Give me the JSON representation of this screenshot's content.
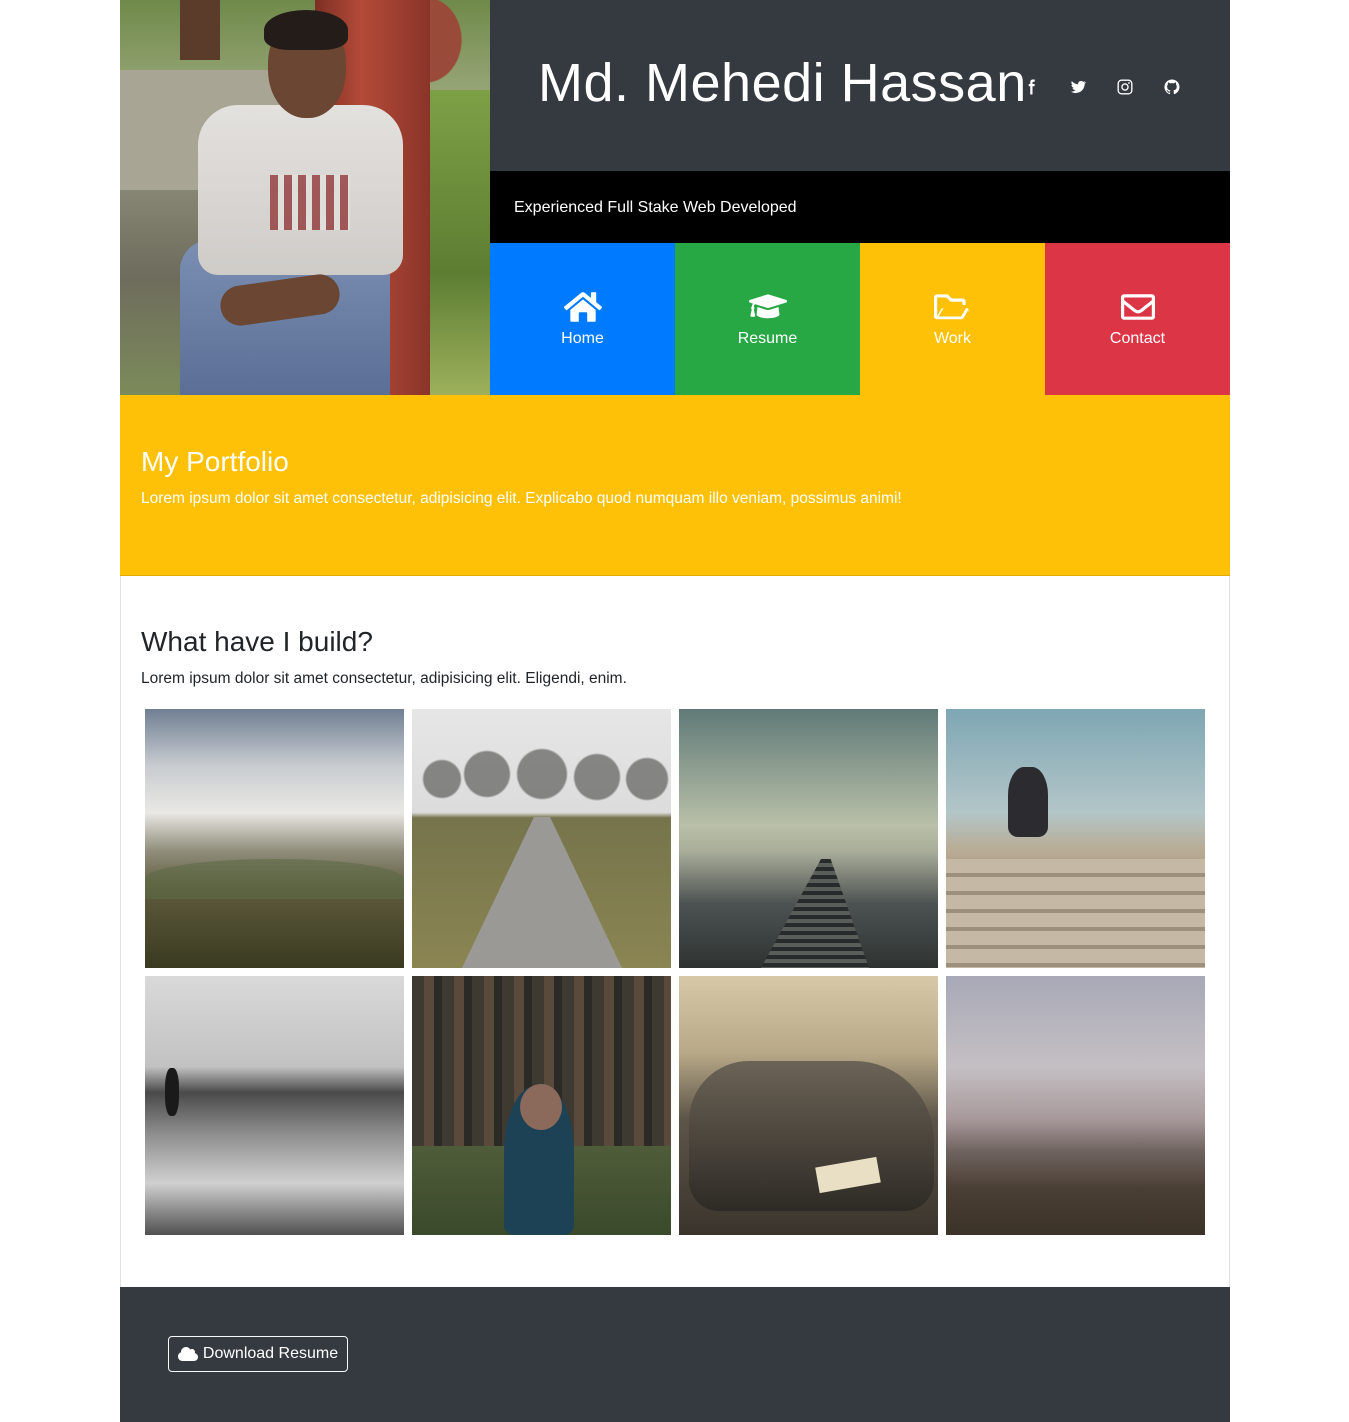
{
  "header": {
    "name": "Md. Mehedi Hassan",
    "tagline": "Experienced Full Stake Web Developed",
    "socials": [
      {
        "icon": "facebook-icon"
      },
      {
        "icon": "twitter-icon"
      },
      {
        "icon": "instagram-icon"
      },
      {
        "icon": "github-icon"
      }
    ]
  },
  "nav": [
    {
      "label": "Home",
      "icon": "home-icon",
      "color": "#007bff"
    },
    {
      "label": "Resume",
      "icon": "graduation-cap-icon",
      "color": "#28a745"
    },
    {
      "label": "Work",
      "icon": "folder-open-icon",
      "color": "#ffc107"
    },
    {
      "label": "Contact",
      "icon": "envelope-icon",
      "color": "#dc3545"
    }
  ],
  "portfolio": {
    "title": "My Portfolio",
    "text": "Lorem ipsum dolor sit amet consectetur, adipisicing elit. Explicabo quod numquam illo veniam, possimus animi!",
    "color": "#ffc107"
  },
  "build": {
    "title": "What have I build?",
    "text": "Lorem ipsum dolor sit amet consectetur, adipisicing elit. Eligendi, enim."
  },
  "footer": {
    "download_label": "Download Resume",
    "icon": "cloud-icon"
  }
}
